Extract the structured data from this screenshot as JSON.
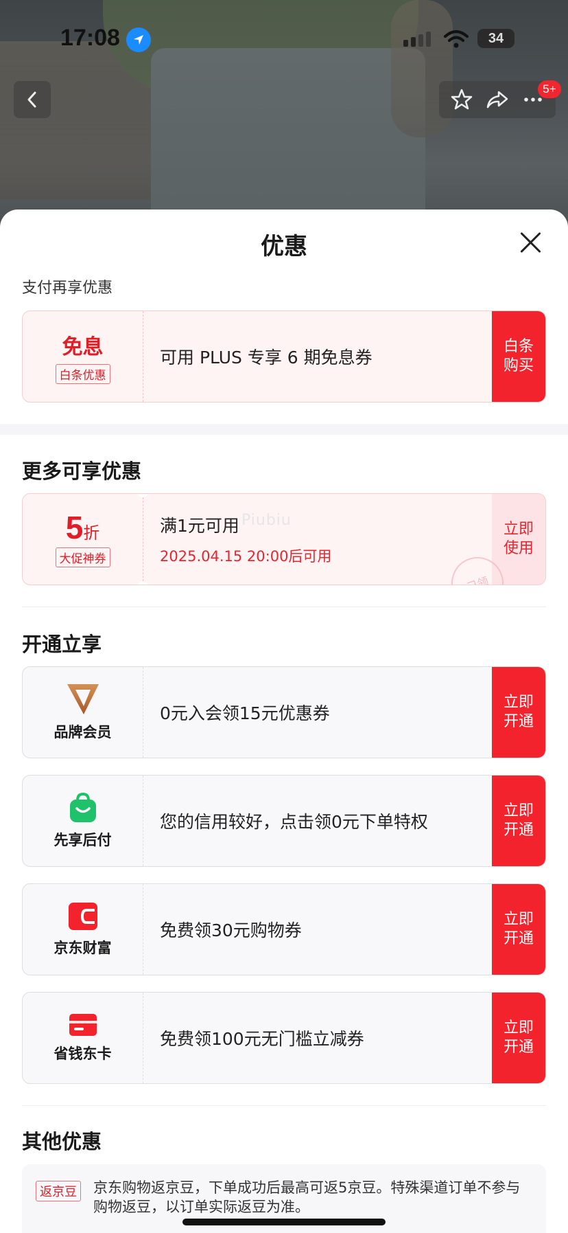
{
  "status_bar": {
    "time": "17:08",
    "battery": "34"
  },
  "nav": {
    "badge": "5+"
  },
  "sheet": {
    "title": "优惠",
    "pay_section": {
      "heading": "支付再享优惠",
      "card": {
        "big_text": "免息",
        "tag": "白条优惠",
        "text": "可用 PLUS 专享 6 期免息券",
        "action": "白条购买"
      }
    },
    "more_section": {
      "heading": "更多可享优惠",
      "card": {
        "discount_num": "5",
        "discount_unit": "折",
        "tag": "大促神券",
        "text": "满1元可用",
        "subtext": "2025.04.15 20:00后可用",
        "action": "立即使用",
        "stamp": "已领"
      },
      "watermark": "Piubiu"
    },
    "open_section": {
      "heading": "开通立享",
      "cards": [
        {
          "label": "品牌会员",
          "icon": "brand-v-icon",
          "text": "0元入会领15元优惠券",
          "action": "立即开通"
        },
        {
          "label": "先享后付",
          "icon": "shopping-bag-icon",
          "text": "您的信用较好，点击领0元下单特权",
          "action": "立即开通"
        },
        {
          "label": "京东财富",
          "icon": "wallet-icon",
          "text": "免费领30元购物券",
          "action": "立即开通"
        },
        {
          "label": "省钱东卡",
          "icon": "card-icon",
          "text": "免费领100元无门槛立减券",
          "action": "立即开通"
        }
      ]
    },
    "other_section": {
      "heading": "其他优惠",
      "tag": "返京豆",
      "text": "京东购物返京豆，下单成功后最高可返5京豆。特殊渠道订单不参与购物返豆，以订单实际返豆为准。"
    }
  },
  "colors": {
    "accent_red": "#f2232c",
    "soft_red": "#fde3e6",
    "text_red": "#e01e27"
  }
}
